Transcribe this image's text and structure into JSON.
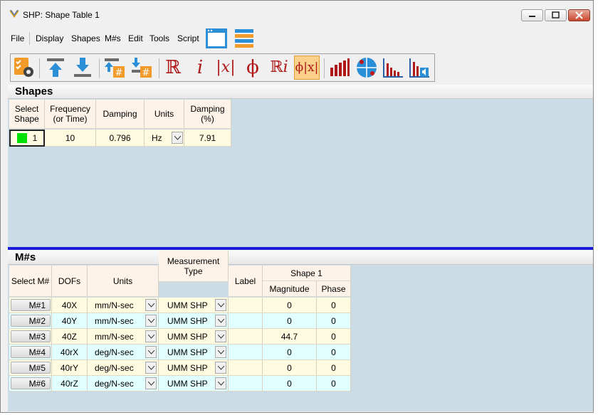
{
  "window": {
    "title": "SHP: Shape Table 1"
  },
  "menu": {
    "items": [
      {
        "label": "File"
      },
      {
        "label": "Display"
      },
      {
        "label": "Shapes"
      },
      {
        "label": "M#s"
      },
      {
        "label": "Edit"
      },
      {
        "label": "Tools"
      },
      {
        "label": "Script"
      }
    ]
  },
  "toolbar": {
    "symbols": {
      "real": "ℝ",
      "imag": "𝑖",
      "mag": "|x|",
      "phase": "ϕ",
      "complex": "ℝ𝑖",
      "phase_mag": "ϕ|x|"
    }
  },
  "shapes": {
    "title": "Shapes",
    "headers": {
      "select": "Select Shape",
      "freq": "Frequency (or Time)",
      "damping": "Damping",
      "units": "Units",
      "damping_pct": "Damping (%)"
    },
    "rows": [
      {
        "select": "1",
        "freq": "10",
        "damping": "0.796",
        "units": "Hz",
        "damping_pct": "7.91",
        "color": "#00e000"
      }
    ]
  },
  "mnums": {
    "title": "M#s",
    "headers": {
      "select": "Select M#",
      "dofs": "DOFs",
      "units": "Units",
      "meas": "Measurement Type",
      "label": "Label",
      "shape": "Shape 1",
      "magnitude": "Magnitude",
      "phase": "Phase"
    },
    "rows": [
      {
        "m": "M#1",
        "dof": "40X",
        "units": "mm/N-sec",
        "meas": "UMM SHP",
        "label": "",
        "mag": "0",
        "phase": "0"
      },
      {
        "m": "M#2",
        "dof": "40Y",
        "units": "mm/N-sec",
        "meas": "UMM SHP",
        "label": "",
        "mag": "0",
        "phase": "0"
      },
      {
        "m": "M#3",
        "dof": "40Z",
        "units": "mm/N-sec",
        "meas": "UMM SHP",
        "label": "",
        "mag": "44.7",
        "phase": "0"
      },
      {
        "m": "M#4",
        "dof": "40rX",
        "units": "deg/N-sec",
        "meas": "UMM SHP",
        "label": "",
        "mag": "0",
        "phase": "0"
      },
      {
        "m": "M#5",
        "dof": "40rY",
        "units": "deg/N-sec",
        "meas": "UMM SHP",
        "label": "",
        "mag": "0",
        "phase": "0"
      },
      {
        "m": "M#6",
        "dof": "40rZ",
        "units": "deg/N-sec",
        "meas": "UMM SHP",
        "label": "",
        "mag": "0",
        "phase": "0"
      }
    ]
  },
  "colors": {
    "section_bg": "#ccdce6",
    "accent_blue": "#1a1ad8",
    "symbol_red": "#b01818",
    "active_tool": "#fbd08a"
  }
}
